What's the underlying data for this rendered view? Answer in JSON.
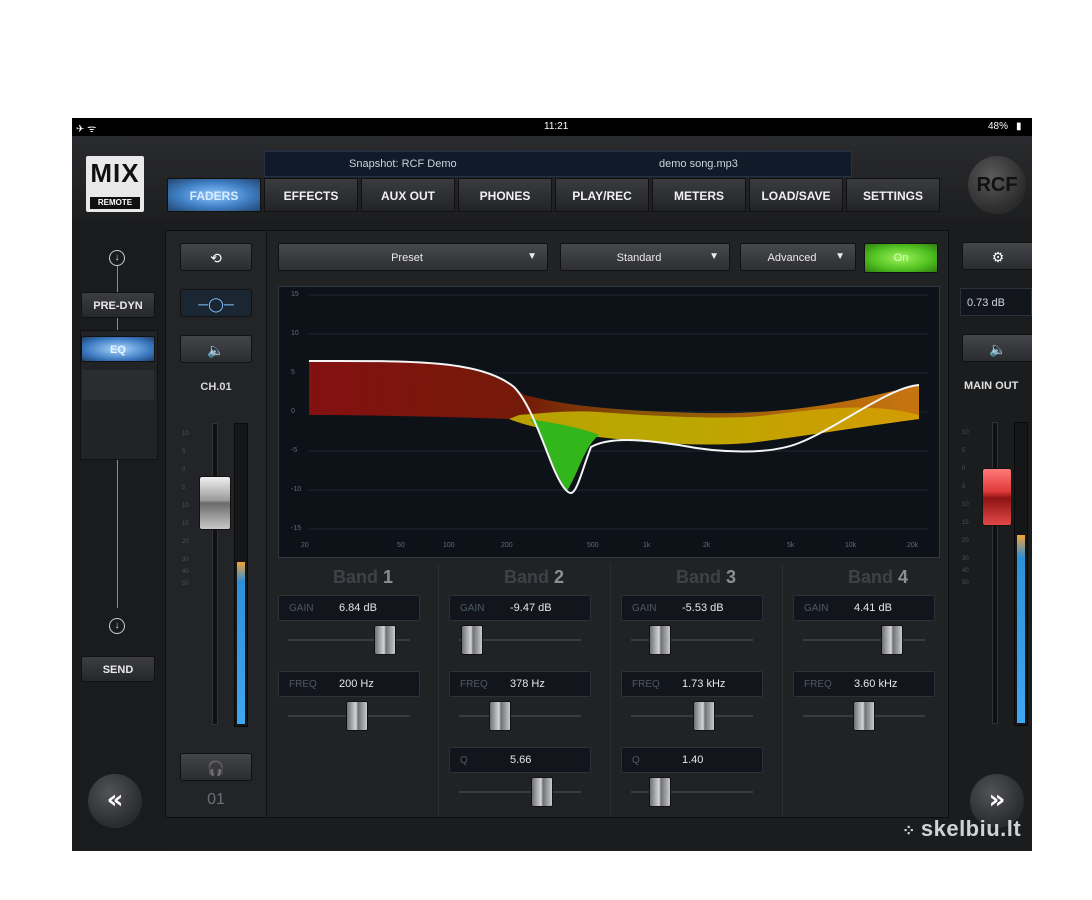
{
  "status": {
    "time": "11:21",
    "battery": "48%"
  },
  "header": {
    "logo_text": "MIX",
    "logo_sub": "REMOTE",
    "brand": "RCF",
    "snapshot": "Snapshot: RCF Demo",
    "song": "demo song.mp3",
    "tabs": [
      {
        "label": "FADERS",
        "active": true
      },
      {
        "label": "EFFECTS"
      },
      {
        "label": "AUX OUT"
      },
      {
        "label": "PHONES"
      },
      {
        "label": "PLAY/REC"
      },
      {
        "label": "METERS"
      },
      {
        "label": "LOAD/SAVE"
      },
      {
        "label": "SETTINGS"
      }
    ]
  },
  "left": {
    "pre_dyn": "PRE-DYN",
    "eq": "EQ",
    "send": "SEND",
    "back_glyph": "«"
  },
  "channel": {
    "name": "CH.01",
    "number": "01",
    "meter_level": 0.92
  },
  "eq": {
    "preset": "Preset",
    "mode": "Standard",
    "view": "Advanced",
    "on_label": "On",
    "y_ticks": [
      "15",
      "10",
      "5",
      "0",
      "-5",
      "-10",
      "-15"
    ],
    "x_ticks": [
      "20",
      "50",
      "100",
      "200",
      "500",
      "1k",
      "2k",
      "5k",
      "10k",
      "20k"
    ],
    "bands": [
      {
        "title": "Band",
        "num": "1",
        "gain_label": "GAIN",
        "gain": "6.84 dB",
        "freq_label": "FREQ",
        "freq": "200 Hz"
      },
      {
        "title": "Band",
        "num": "2",
        "gain_label": "GAIN",
        "gain": "-9.47 dB",
        "freq_label": "FREQ",
        "freq": "378 Hz",
        "q_label": "Q",
        "q": "5.66"
      },
      {
        "title": "Band",
        "num": "3",
        "gain_label": "GAIN",
        "gain": "-5.53 dB",
        "freq_label": "FREQ",
        "freq": "1.73 kHz",
        "q_label": "Q",
        "q": "1.40"
      },
      {
        "title": "Band",
        "num": "4",
        "gain_label": "GAIN",
        "gain": "4.41 dB",
        "freq_label": "FREQ",
        "freq": "3.60 kHz"
      }
    ]
  },
  "right": {
    "gain": "0.73 dB",
    "label": "MAIN OUT",
    "forward_glyph": "»"
  },
  "watermark": "skelbiu.lt",
  "colors": {
    "accent_blue": "#3f7fc4",
    "on_green": "#5fd12c",
    "main_fader": "#e03a3a"
  }
}
